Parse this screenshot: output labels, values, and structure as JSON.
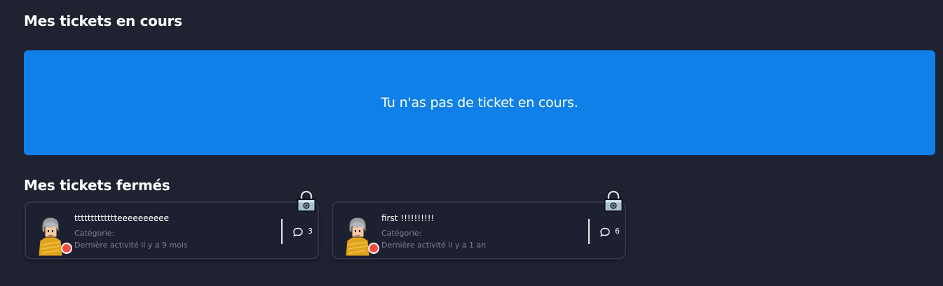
{
  "open_section": {
    "title": "Mes tickets en cours",
    "empty_message": "Tu n'as pas de ticket en cours."
  },
  "closed_section": {
    "title": "Mes tickets fermés",
    "tickets": [
      {
        "title": "ttttttttttttteeeeeeeeee",
        "category": "Catégorie:",
        "activity": "Dernière activité il y a 9 mois",
        "comments": "3",
        "status": "closed",
        "status_color": "#f04c3e"
      },
      {
        "title": "first !!!!!!!!!!",
        "category": "Catégorie:",
        "activity": "Dernière activité il y a 1 an",
        "comments": "6",
        "status": "closed",
        "status_color": "#f04c3e"
      }
    ]
  },
  "colors": {
    "background": "#1f2230",
    "banner": "#0f80e8",
    "card_border": "#33364a",
    "muted_text": "#7d8196"
  },
  "icons": {
    "closed_ticket": "padlock-icon",
    "comments": "speech-bubble-icon",
    "avatar": "habbo-avatar"
  }
}
